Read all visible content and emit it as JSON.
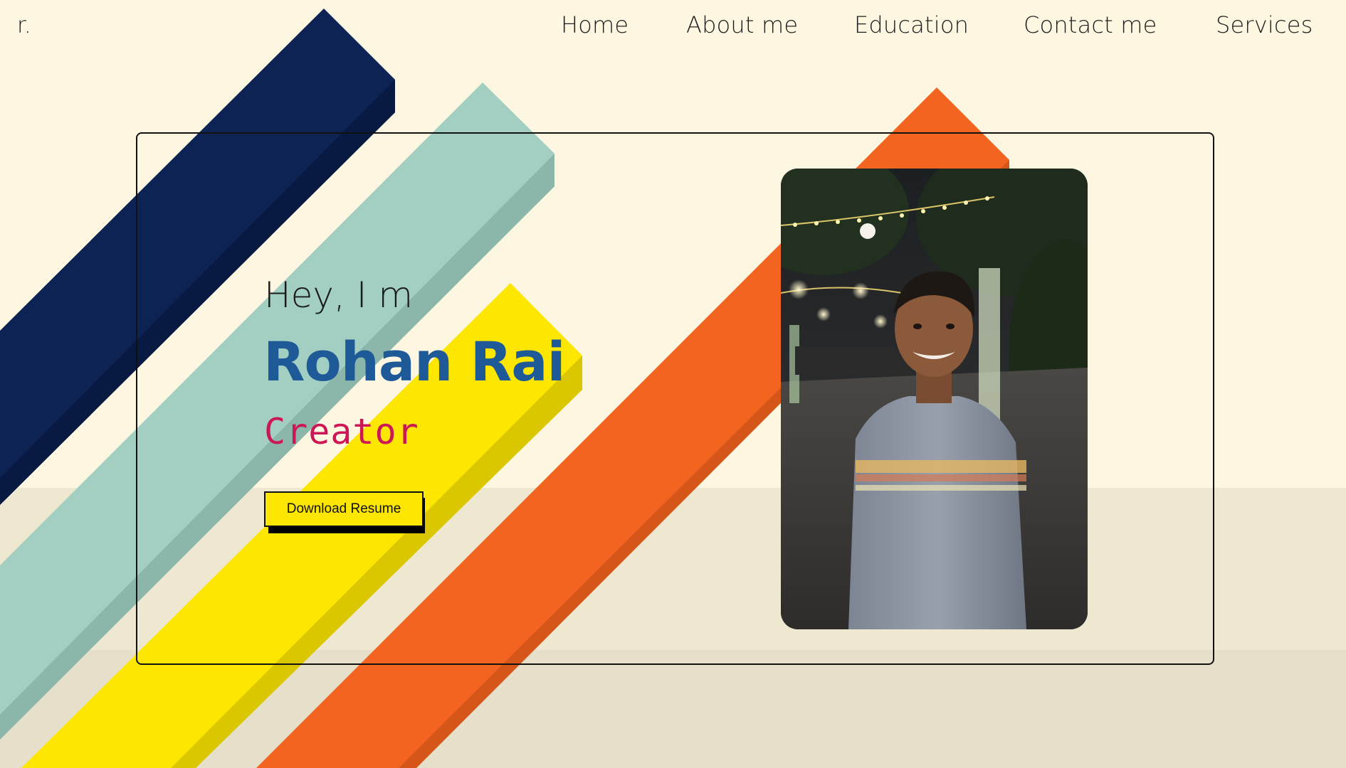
{
  "brand": {
    "logo_text": "r."
  },
  "nav": {
    "items": [
      {
        "label": "Home"
      },
      {
        "label": "About me"
      },
      {
        "label": "Education"
      },
      {
        "label": "Contact me"
      },
      {
        "label": "Services"
      }
    ]
  },
  "hero": {
    "greeting": "Hey, I m",
    "name": "Rohan Rai",
    "role": "Creator",
    "download_button": "Download Resume"
  },
  "profile_photo": {
    "subject": "smiling man in striped shirt at night with string lights"
  },
  "colors": {
    "background": "#fdf7e1",
    "stripe_navy": "#0c2354",
    "stripe_mint": "#a3cfc2",
    "stripe_yellow": "#fde600",
    "stripe_orange": "#f2641f",
    "name_blue": "#1e5a97",
    "role_pink": "#cc1656"
  }
}
